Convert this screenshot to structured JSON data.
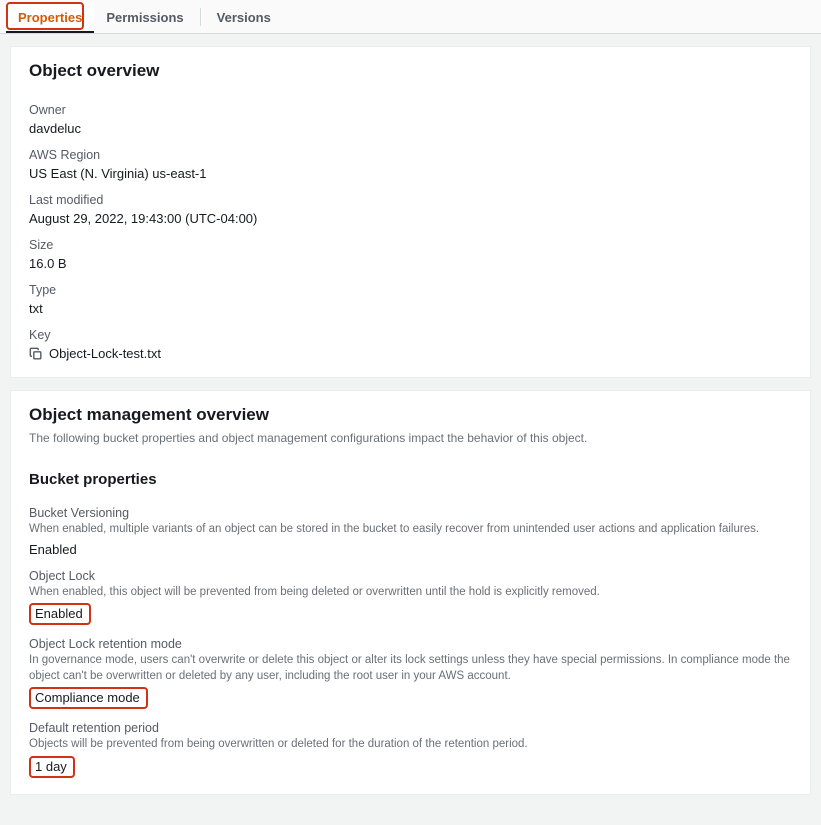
{
  "tabs": {
    "properties": "Properties",
    "permissions": "Permissions",
    "versions": "Versions"
  },
  "overview": {
    "title": "Object overview",
    "owner_label": "Owner",
    "owner_value": "davdeluc",
    "region_label": "AWS Region",
    "region_value": "US East (N. Virginia) us-east-1",
    "modified_label": "Last modified",
    "modified_value": "August 29, 2022, 19:43:00 (UTC-04:00)",
    "size_label": "Size",
    "size_value": "16.0 B",
    "type_label": "Type",
    "type_value": "txt",
    "key_label": "Key",
    "key_value": "Object-Lock-test.txt"
  },
  "mgmt": {
    "title": "Object management overview",
    "desc": "The following bucket properties and object management configurations impact the behavior of this object.",
    "bucket_props_title": "Bucket properties",
    "versioning_label": "Bucket Versioning",
    "versioning_desc": "When enabled, multiple variants of an object can be stored in the bucket to easily recover from unintended user actions and application failures.",
    "versioning_value": "Enabled",
    "lock_label": "Object Lock",
    "lock_desc": "When enabled, this object will be prevented from being deleted or overwritten until the hold is explicitly removed.",
    "lock_value": "Enabled",
    "retmode_label": "Object Lock retention mode",
    "retmode_desc": "In governance mode, users can't overwrite or delete this object or alter its lock settings unless they have special permissions. In compliance mode the object can't be overwritten or deleted by any user, including the root user in your AWS account.",
    "retmode_value": "Compliance mode",
    "retperiod_label": "Default retention period",
    "retperiod_desc": "Objects will be prevented from being overwritten or deleted for the duration of the retention period.",
    "retperiod_value": "1 day"
  }
}
